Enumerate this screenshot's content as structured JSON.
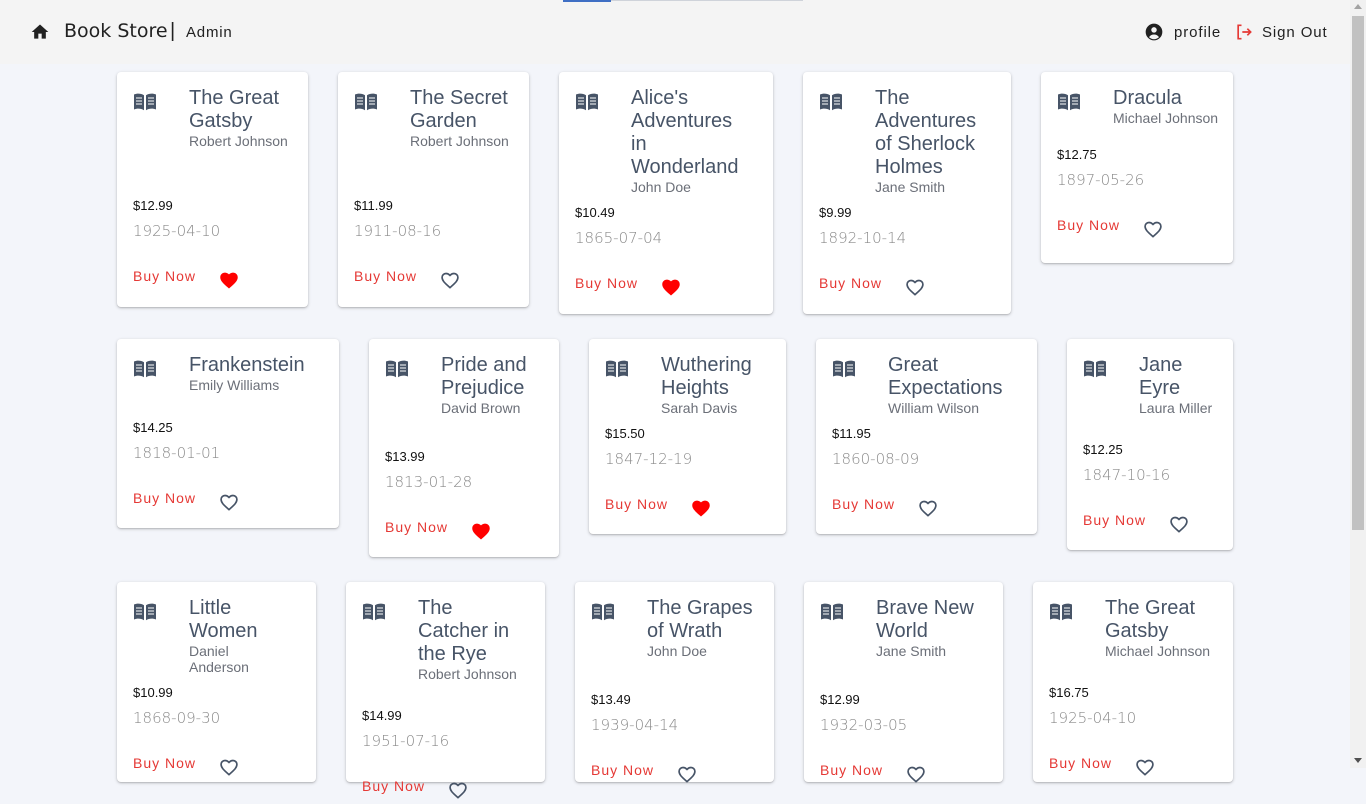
{
  "header": {
    "brand": "Book Store",
    "separator": "|",
    "role": "Admin",
    "profile_label": "profile",
    "signout_label": "Sign Out"
  },
  "colors": {
    "accent_red": "#e53935",
    "heart_red": "#ff0000",
    "title_slate": "#475467"
  },
  "books": [
    {
      "title": "The Great Gatsby",
      "author": "Robert Johnson",
      "price": "$12.99",
      "date": "1925-04-10",
      "buy": "Buy Now",
      "favorite": true
    },
    {
      "title": "The Secret Garden",
      "author": "Robert Johnson",
      "price": "$11.99",
      "date": "1911-08-16",
      "buy": "Buy Now",
      "favorite": false
    },
    {
      "title": "Alice's Adventures in Wonderland",
      "author": "John Doe",
      "price": "$10.49",
      "date": "1865-07-04",
      "buy": "Buy Now",
      "favorite": true
    },
    {
      "title": "The Adventures of Sherlock Holmes",
      "author": "Jane Smith",
      "price": "$9.99",
      "date": "1892-10-14",
      "buy": "Buy Now",
      "favorite": false
    },
    {
      "title": "Dracula",
      "author": "Michael Johnson",
      "price": "$12.75",
      "date": "1897-05-26",
      "buy": "Buy Now",
      "favorite": false
    },
    {
      "title": "Frankenstein",
      "author": "Emily Williams",
      "price": "$14.25",
      "date": "1818-01-01",
      "buy": "Buy Now",
      "favorite": false
    },
    {
      "title": "Pride and Prejudice",
      "author": "David Brown",
      "price": "$13.99",
      "date": "1813-01-28",
      "buy": "Buy Now",
      "favorite": true
    },
    {
      "title": "Wuthering Heights",
      "author": "Sarah Davis",
      "price": "$15.50",
      "date": "1847-12-19",
      "buy": "Buy Now",
      "favorite": true
    },
    {
      "title": "Great Expectations",
      "author": "William Wilson",
      "price": "$11.95",
      "date": "1860-08-09",
      "buy": "Buy Now",
      "favorite": false
    },
    {
      "title": "Jane Eyre",
      "author": "Laura Miller",
      "price": "$12.25",
      "date": "1847-10-16",
      "buy": "Buy Now",
      "favorite": false
    },
    {
      "title": "Little Women",
      "author": "Daniel Anderson",
      "price": "$10.99",
      "date": "1868-09-30",
      "buy": "Buy Now",
      "favorite": false
    },
    {
      "title": "The Catcher in the Rye",
      "author": "Robert Johnson",
      "price": "$14.99",
      "date": "1951-07-16",
      "buy": "Buy Now",
      "favorite": false
    },
    {
      "title": "The Grapes of Wrath",
      "author": "John Doe",
      "price": "$13.49",
      "date": "1939-04-14",
      "buy": "Buy Now",
      "favorite": false
    },
    {
      "title": "Brave New World",
      "author": "Jane Smith",
      "price": "$12.99",
      "date": "1932-03-05",
      "buy": "Buy Now",
      "favorite": false
    },
    {
      "title": "The Great Gatsby",
      "author": "Michael Johnson",
      "price": "$16.75",
      "date": "1925-04-10",
      "buy": "Buy Now",
      "favorite": false
    }
  ]
}
